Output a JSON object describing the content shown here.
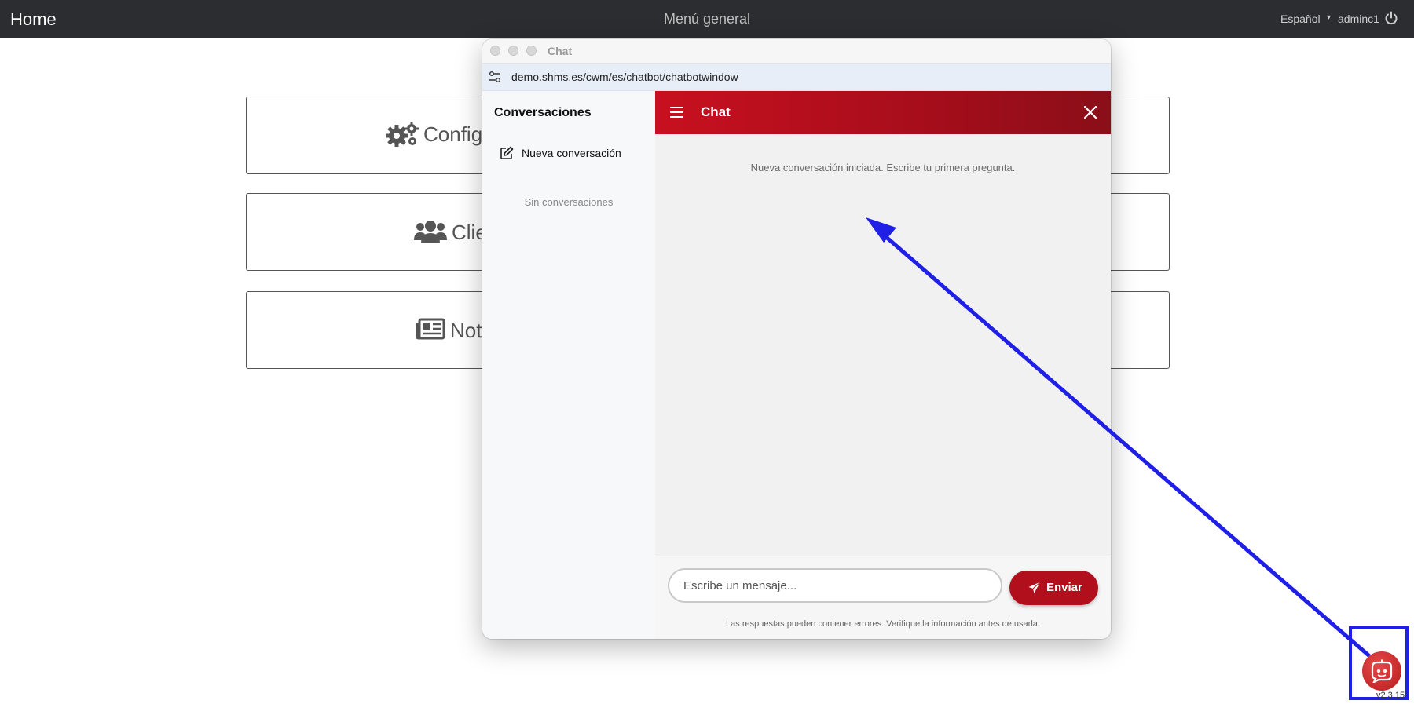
{
  "topbar": {
    "brand": "Home",
    "title": "Menú general",
    "language": "Español",
    "user": "adminc1"
  },
  "cards": [
    {
      "label": "Config",
      "icon": "gears-icon"
    },
    {
      "label": "Clie",
      "icon": "users-icon"
    },
    {
      "label": "Not",
      "icon": "newspaper-icon"
    }
  ],
  "chat_window": {
    "title": "Chat",
    "url": "demo.shms.es/cwm/es/chatbot/chatbotwindow",
    "sidebar": {
      "title": "Conversaciones",
      "new_conversation": "Nueva conversación",
      "empty": "Sin conversaciones"
    },
    "header": {
      "title": "Chat"
    },
    "system_message": "Nueva conversación iniciada. Escribe tu primera pregunta.",
    "input": {
      "placeholder": "Escribe un mensaje...",
      "value": ""
    },
    "send_label": "Enviar",
    "disclaimer": "Las respuestas pueden contener errores. Verifique la información antes de usarla."
  },
  "colors": {
    "brand_red": "#b10f1c",
    "annotation_blue": "#1f1fe6",
    "topbar": "#2b2d31"
  },
  "version": "v2.3.15"
}
